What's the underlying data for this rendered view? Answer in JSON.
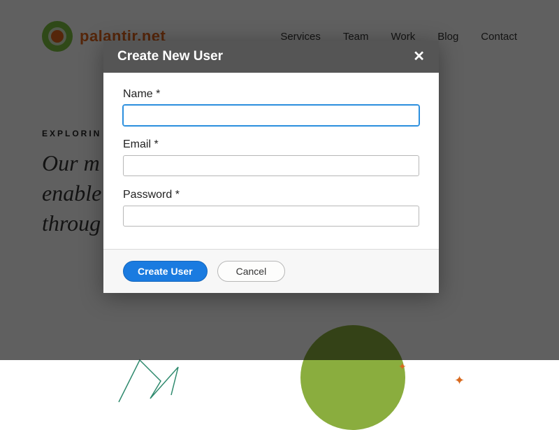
{
  "site": {
    "logo_text": "palantir.net",
    "nav": {
      "services": "Services",
      "team": "Team",
      "work": "Work",
      "blog": "Blog",
      "contact": "Contact"
    },
    "hero": {
      "eyebrow": "EXPLORIN",
      "mission_visible": "Our m                                                and enable                                                mation throug                                               intera"
    }
  },
  "modal": {
    "title": "Create New User",
    "close_glyph": "✕",
    "fields": {
      "name": {
        "label": "Name *",
        "value": ""
      },
      "email": {
        "label": "Email *",
        "value": ""
      },
      "password": {
        "label": "Password *",
        "value": ""
      }
    },
    "buttons": {
      "submit": "Create User",
      "cancel": "Cancel"
    }
  }
}
